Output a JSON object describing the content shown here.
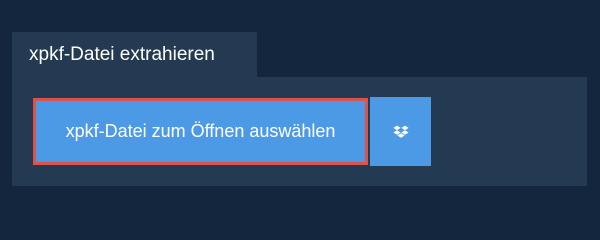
{
  "tab": {
    "label": "xpkf-Datei extrahieren"
  },
  "actions": {
    "select_file_label": "xpkf-Datei zum Öffnen auswählen",
    "dropbox_icon": "dropbox-icon"
  },
  "colors": {
    "background": "#13263d",
    "panel": "#233a52",
    "button": "#4c9ae6",
    "focus_border": "#d9534f",
    "text": "#ffffff"
  }
}
